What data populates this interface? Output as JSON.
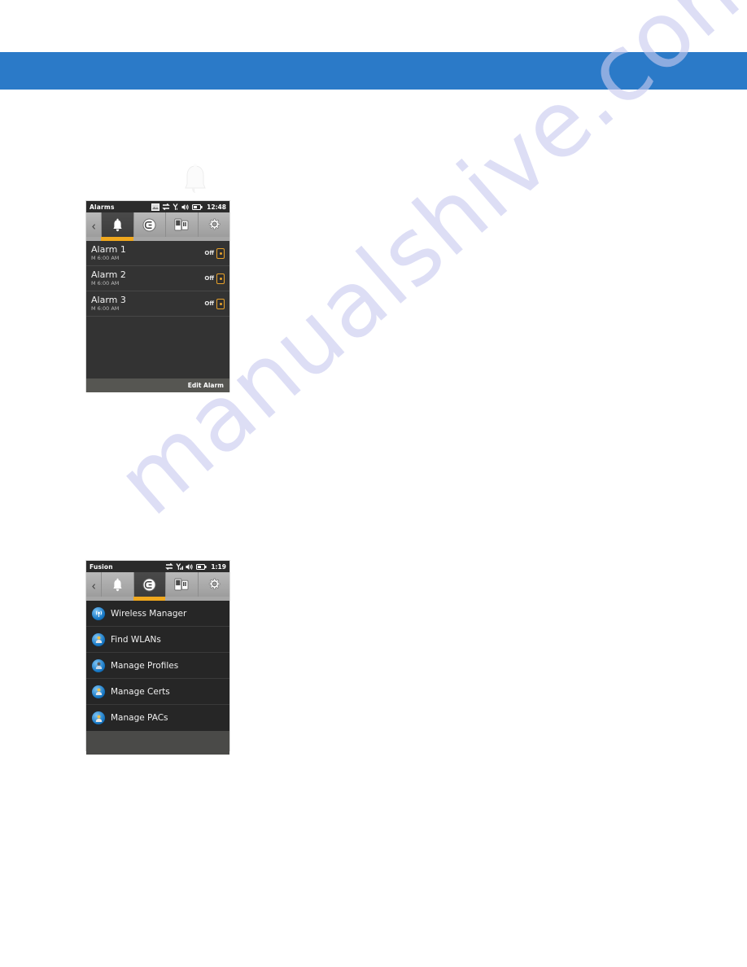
{
  "page": {
    "background_color": "#ffffff",
    "band_color": "#2b7ac8",
    "accent_color": "#f0a81e",
    "watermark_text": "manualshive.com",
    "watermark_color": "#c9cbf0"
  },
  "bell_graphic": {
    "icon": "bell-icon"
  },
  "alarms_screenshot": {
    "status_bar": {
      "title": "Alarms",
      "time": "12:48",
      "icons": [
        "picture-icon",
        "sync-icon",
        "signal-icon",
        "volume-icon",
        "battery-icon"
      ]
    },
    "tabs": {
      "back_icon": "chevron-left-icon",
      "items": [
        {
          "icon": "bell-icon",
          "name": "alarms",
          "selected": true
        },
        {
          "icon": "fusion-icon",
          "name": "fusion",
          "selected": false
        },
        {
          "icon": "device-icon",
          "name": "device",
          "selected": false
        },
        {
          "icon": "gear-icon",
          "name": "settings",
          "selected": false
        }
      ]
    },
    "alarms": [
      {
        "title": "Alarm 1",
        "schedule": "M 6:00 AM",
        "state": "Off"
      },
      {
        "title": "Alarm 2",
        "schedule": "M 6:00 AM",
        "state": "Off"
      },
      {
        "title": "Alarm 3",
        "schedule": "M 6:00 AM",
        "state": "Off"
      }
    ],
    "bottom_bar": {
      "action_label": "Edit Alarm"
    }
  },
  "fusion_screenshot": {
    "status_bar": {
      "title": "Fusion",
      "time": "1:19",
      "icons": [
        "sync-icon",
        "signal-icon",
        "volume-icon",
        "battery-icon"
      ]
    },
    "tabs": {
      "back_icon": "chevron-left-icon",
      "items": [
        {
          "icon": "bell-icon",
          "name": "alarms",
          "selected": false
        },
        {
          "icon": "fusion-icon",
          "name": "fusion",
          "selected": true
        },
        {
          "icon": "device-icon",
          "name": "device",
          "selected": false
        },
        {
          "icon": "gear-icon",
          "name": "settings",
          "selected": false
        }
      ]
    },
    "menu_items": [
      {
        "label": "Wireless Manager",
        "icon": "wireless-manager-icon"
      },
      {
        "label": "Find WLANs",
        "icon": "find-wlans-icon"
      },
      {
        "label": "Manage Profiles",
        "icon": "manage-profiles-icon"
      },
      {
        "label": "Manage Certs",
        "icon": "manage-certs-icon"
      },
      {
        "label": "Manage PACs",
        "icon": "manage-pacs-icon"
      }
    ]
  }
}
